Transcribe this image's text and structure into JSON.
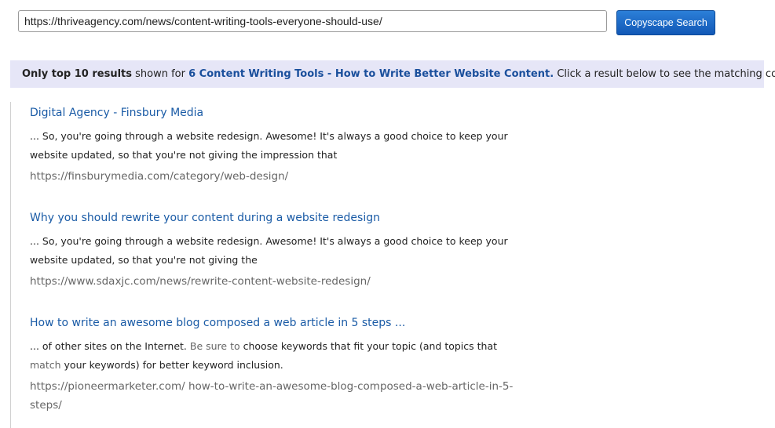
{
  "search": {
    "url_value": "https://thriveagency.com/news/content-writing-tools-everyone-should-use/",
    "button_label": "Copyscape Search"
  },
  "banner": {
    "prefix_bold": "Only top 10 results",
    "prefix_text": " shown for ",
    "page_title": "6 Content Writing Tools - How to Write Better Website Content.",
    "suffix": " Click a result below to see the matching content."
  },
  "results": [
    {
      "title": "Digital Agency - Finsbury Media",
      "snippet": "... So, you're going through a website redesign. Awesome! It's always a good choice to keep your website updated, so that you're not giving the impression that",
      "url": "https://finsburymedia.com/category/web-design/"
    },
    {
      "title": "Why you should rewrite your content during a website redesign",
      "snippet": "... So, you're going through a website redesign. Awesome! It's always a good choice to keep your website updated, so that you're not giving the",
      "url": "https://www.sdaxjc.com/news/rewrite-content-website-redesign/"
    },
    {
      "title": "How to write an awesome blog composed a web article in 5 steps ...",
      "snippet_parts": [
        "... of other sites on the Internet. ",
        "Be sure to",
        " choose keywords that fit your topic (and topics that ",
        "match",
        " your keywords) for better keyword inclusion."
      ],
      "url": "https://pioneermarketer.com/ how-to-write-an-awesome-blog-composed-a-web-article-in-5-steps/"
    }
  ]
}
